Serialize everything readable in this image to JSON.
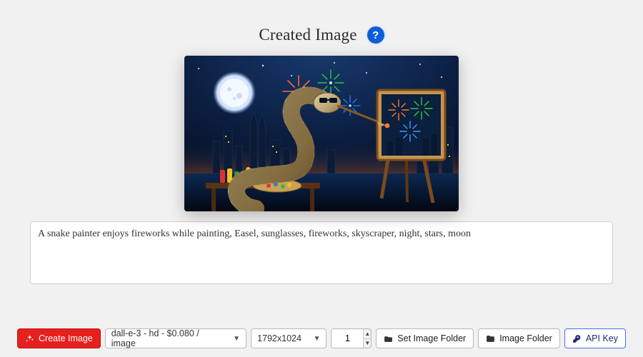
{
  "header": {
    "title": "Created Image",
    "help_glyph": "?"
  },
  "prompt": {
    "value": "A snake painter enjoys fireworks while painting, Easel, sunglasses, fireworks, skyscraper, night, stars, moon"
  },
  "toolbar": {
    "create_label": "Create Image",
    "model": {
      "selected": "dall-e-3 - hd - $0.080 / image"
    },
    "size": {
      "selected": "1792x1024"
    },
    "count": {
      "value": "1"
    },
    "set_folder_label": "Set Image Folder",
    "open_folder_label": "Image Folder",
    "api_key_label": "API Key"
  }
}
